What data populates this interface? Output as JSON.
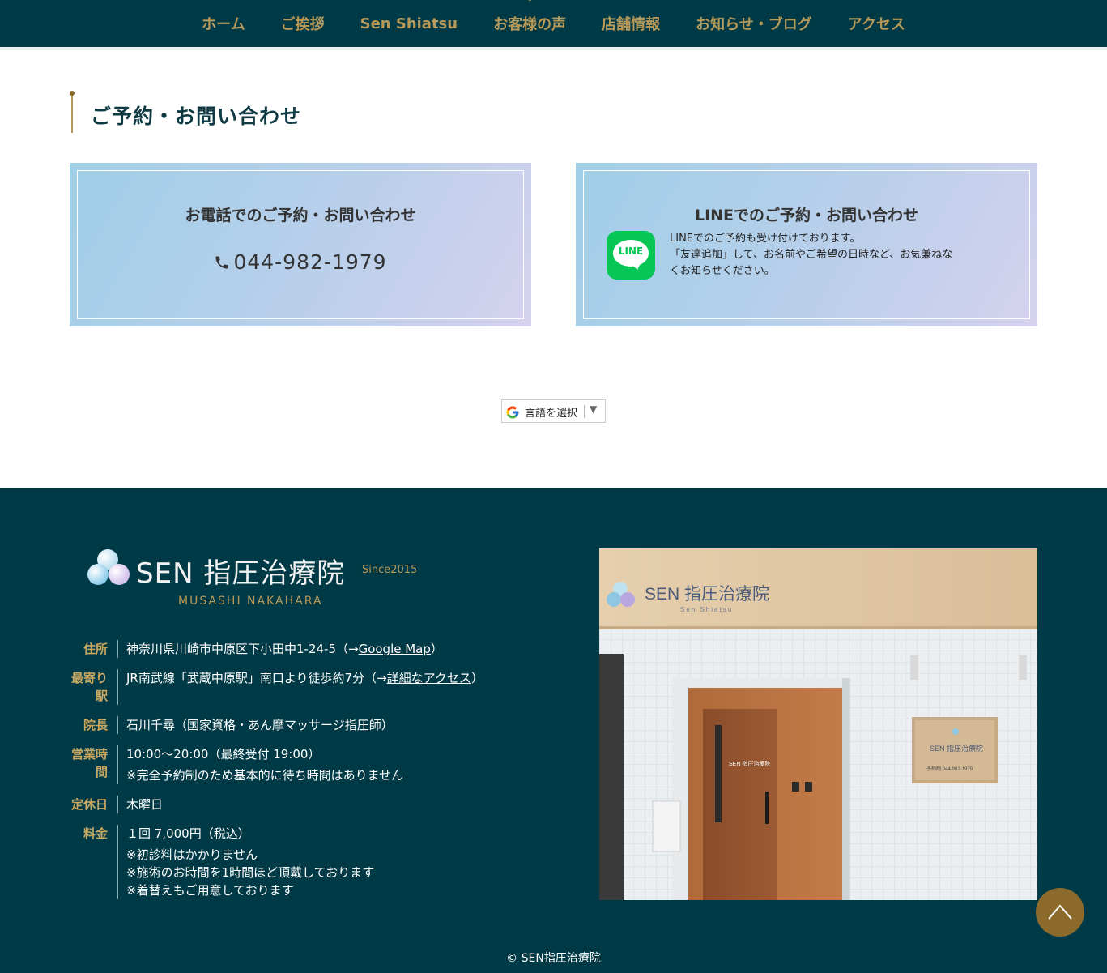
{
  "nav": {
    "items": [
      {
        "label": "ホーム"
      },
      {
        "label": "ご挨拶"
      },
      {
        "label": "Sen Shiatsu"
      },
      {
        "label": "お客様の声"
      },
      {
        "label": "店舗情報"
      },
      {
        "label": "お知らせ・ブログ"
      },
      {
        "label": "アクセス"
      }
    ]
  },
  "contact": {
    "heading": "ご予約・お問い合わせ",
    "phone": {
      "title": "お電話でのご予約・お問い合わせ",
      "number": "044-982-1979",
      "icon": "phone-icon"
    },
    "line": {
      "title": "LINEでのご予約・お問い合わせ",
      "logo_text": "LINE",
      "text_1": "LINEでのご予約も受け付けております。",
      "text_2": "「友達追加」して、お名前やご希望の日時など、お気兼ねな",
      "text_3": "くお知らせください。"
    }
  },
  "translate": {
    "label": "言語を選択",
    "arrow": "▼"
  },
  "footer": {
    "logo": {
      "name": "SEN 指圧治療院",
      "since": "Since2015",
      "sub": "MUSASHI NAKAHARA"
    },
    "info": {
      "address": {
        "label": "住所",
        "text": "神奈川県川崎市中原区下小田中1-24-5（→",
        "link": "Google Map",
        "after": "）"
      },
      "station": {
        "label": "最寄り駅",
        "text": "JR南武線「武蔵中原駅」南口より徒歩約7分（→",
        "link": "詳細なアクセス",
        "after": "）"
      },
      "director": {
        "label": "院長",
        "text": "石川千尋（国家資格・あん摩マッサージ指圧師）"
      },
      "hours": {
        "label": "営業時間",
        "line1": "10:00〜20:00（最終受付 19:00）",
        "line2": "※完全予約制のため基本的に待ち時間はありません"
      },
      "holiday": {
        "label": "定休日",
        "text": "木曜日"
      },
      "price": {
        "label": "料金",
        "line1": "１回 7,000円（税込）",
        "line2": "※初診料はかかりません",
        "line3": "※施術のお時間を1時間ほど頂戴しております",
        "line4": "※着替えもご用意しております"
      }
    },
    "photo_sign": "SEN 指圧治療院",
    "photo_sign_sub": "Sen Shiatsu",
    "copyright": "© SEN指圧治療院"
  },
  "colors": {
    "navy": "#003a46",
    "gold": "#b79a5a",
    "line_green": "#06c755"
  }
}
